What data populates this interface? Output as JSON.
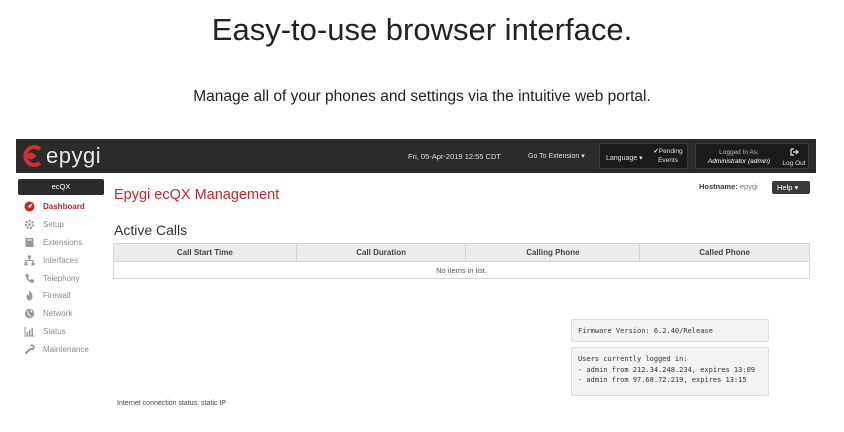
{
  "hero": {
    "headline": "Easy-to-use browser interface.",
    "subline": "Manage all of your phones and settings via the intuitive web portal."
  },
  "topbar": {
    "logo_text": "epygi",
    "datetime": "Fri, 05-Apr-2019 12:55 CDT",
    "goto_extension": "Go To Extension",
    "language": "Language",
    "pending_line1": "Pending",
    "pending_line2": "Events",
    "logged_in_label": "Logged In As:",
    "logged_in_user": "Administrator (admin)",
    "logout": "Log Out"
  },
  "sidebar": {
    "header": "ecQX",
    "items": [
      {
        "label": "Dashboard",
        "icon": "dashboard-icon",
        "active": true
      },
      {
        "label": "Setup",
        "icon": "gear-icon",
        "active": false
      },
      {
        "label": "Extensions",
        "icon": "book-icon",
        "active": false
      },
      {
        "label": "Interfaces",
        "icon": "sitemap-icon",
        "active": false
      },
      {
        "label": "Telephony",
        "icon": "phone-icon",
        "active": false
      },
      {
        "label": "Firewall",
        "icon": "fire-icon",
        "active": false
      },
      {
        "label": "Network",
        "icon": "globe-icon",
        "active": false
      },
      {
        "label": "Status",
        "icon": "bar-chart-icon",
        "active": false
      },
      {
        "label": "Maintenance",
        "icon": "wrench-icon",
        "active": false
      }
    ]
  },
  "main": {
    "title": "Epygi ecQX Management",
    "hostname_label": "Hostname:",
    "hostname_value": "epygi",
    "help": "Help",
    "section_title": "Active Calls",
    "table": {
      "columns": [
        "Call Start Time",
        "Call Duration",
        "Calling Phone",
        "Called Phone"
      ],
      "empty_message": "No items in list."
    },
    "firmware": "Firmware Version: 6.2.40/Release",
    "users_header": "Users currently logged in:",
    "users": [
      "- admin from 212.34.248.234, expires 13:09",
      "- admin from 97.68.72.219, expires 13:15"
    ],
    "internet_status": "Internet connection status: static IP"
  },
  "colors": {
    "accent_red": "#c62828",
    "topbar_bg": "#2b2b2b"
  }
}
